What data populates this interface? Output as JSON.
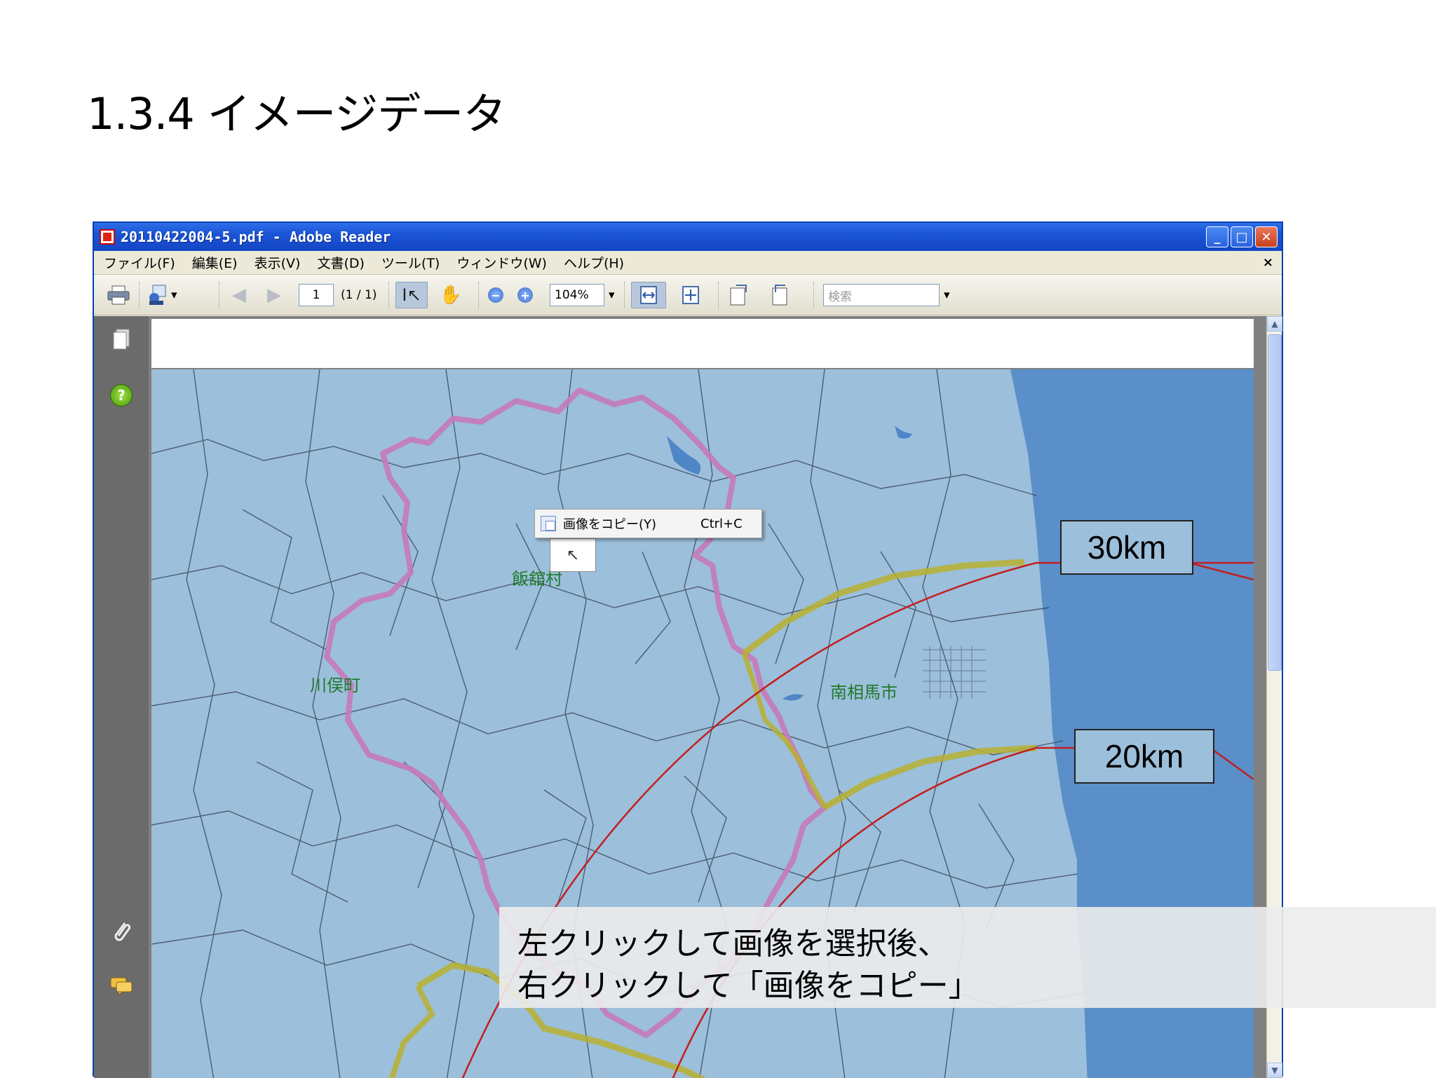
{
  "slide": {
    "title": "1.3.4 イメージデータ"
  },
  "window": {
    "title": "20110422004-5.pdf - Adobe Reader",
    "buttons": {
      "minimize": "_",
      "maximize": "□",
      "close": "✕"
    }
  },
  "menu": {
    "items": [
      "ファイル(F)",
      "編集(E)",
      "表示(V)",
      "文書(D)",
      "ツール(T)",
      "ウィンドウ(W)",
      "ヘルプ(H)"
    ],
    "doc_close": "×"
  },
  "toolbar": {
    "page_number": "1",
    "page_count": "(1 / 1)",
    "zoom": "104%",
    "search_placeholder": "検索"
  },
  "context_menu": {
    "label": "画像をコピー(Y)",
    "shortcut": "Ctrl+C"
  },
  "map": {
    "places": [
      "飯舘村",
      "川俣町",
      "南相馬市"
    ],
    "radius_labels": [
      "30km",
      "20km"
    ],
    "colors": {
      "sea": "#5b8fc9",
      "land": "#9cbfdb",
      "border": "#c57ab8",
      "ring": "#c21f1f",
      "zone": "#b8b030"
    }
  },
  "caption": {
    "line1": "左クリックして画像を選択後、",
    "line2": "右クリックして「画像をコピー」"
  }
}
